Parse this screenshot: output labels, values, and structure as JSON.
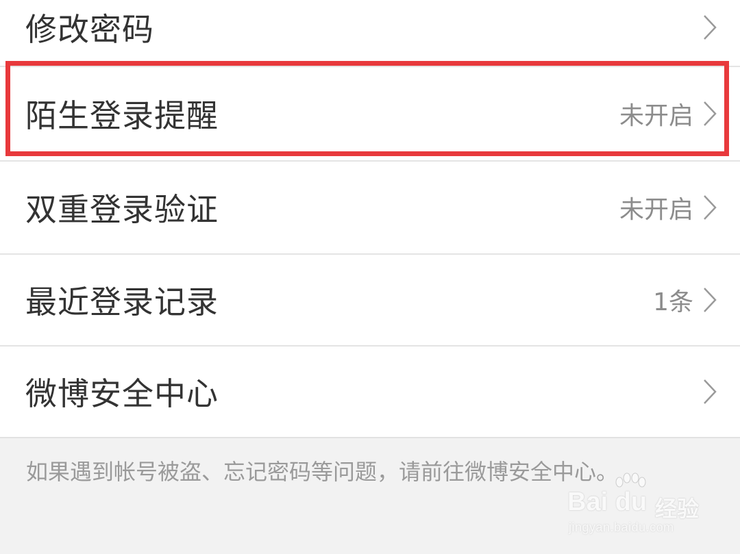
{
  "settings_list": {
    "items": [
      {
        "label": "修改密码",
        "value": "",
        "icon": "chevron-right-icon"
      },
      {
        "label": "陌生登录提醒",
        "value": "未开启",
        "icon": "chevron-right-icon"
      },
      {
        "label": "双重登录验证",
        "value": "未开启",
        "icon": "chevron-right-icon"
      },
      {
        "label": "最近登录记录",
        "value": "1条",
        "icon": "chevron-right-icon"
      },
      {
        "label": "微博安全中心",
        "value": "",
        "icon": "chevron-right-icon"
      }
    ]
  },
  "footer": {
    "note": "如果遇到帐号被盗、忘记密码等问题，请前往微博安全中心。"
  },
  "watermark": {
    "brand": "Bai du",
    "product": "经验",
    "url": "jingyan.baidu.com"
  },
  "colors": {
    "highlight_border": "#e8393c",
    "label_text": "#333333",
    "value_text": "#8c8c8c",
    "background": "#f2f2f2"
  }
}
